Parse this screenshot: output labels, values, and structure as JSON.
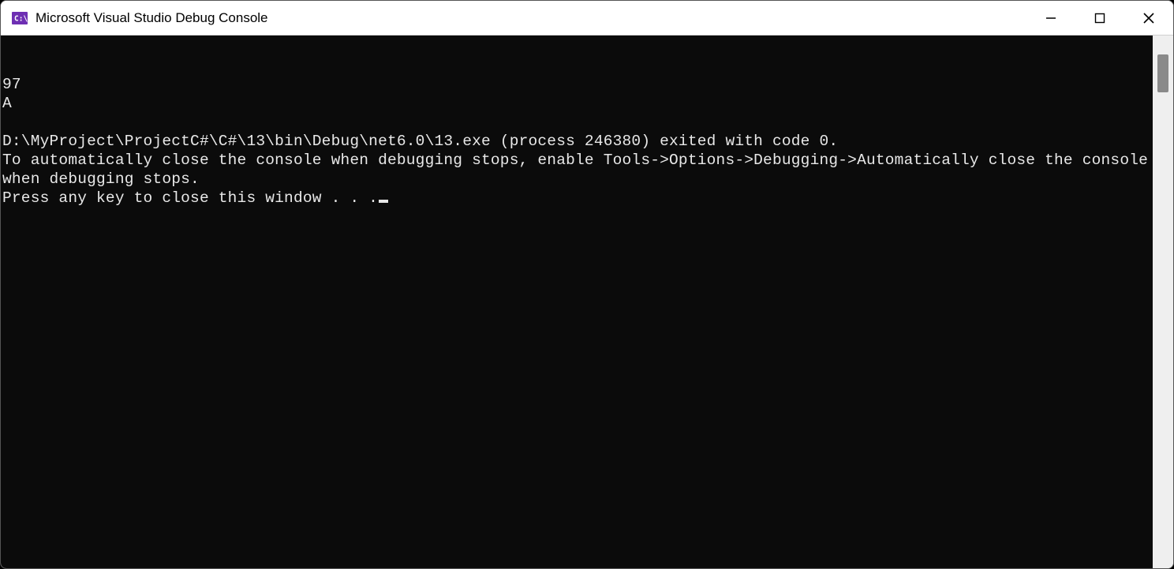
{
  "window": {
    "title": "Microsoft Visual Studio Debug Console",
    "icon_bg": "#6e2fb3",
    "icon_text": "C:\\"
  },
  "console": {
    "lines": [
      "97",
      "A",
      "",
      "D:\\MyProject\\ProjectC#\\C#\\13\\bin\\Debug\\net6.0\\13.exe (process 246380) exited with code 0.",
      "To automatically close the console when debugging stops, enable Tools->Options->Debugging->Automatically close the console when debugging stops.",
      "Press any key to close this window . . ."
    ]
  }
}
